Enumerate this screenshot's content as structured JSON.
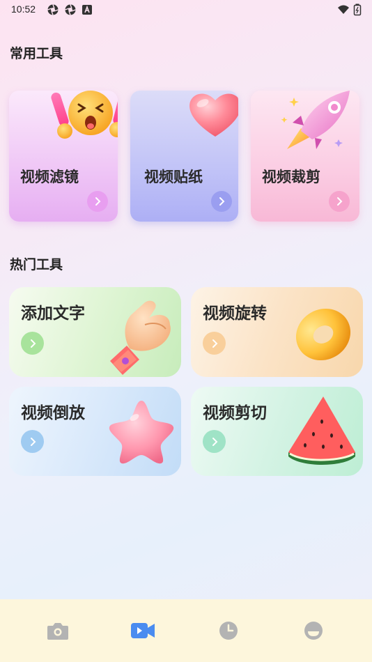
{
  "status_bar": {
    "time": "10:52",
    "left_icons": [
      "aperture-icon",
      "aperture-icon",
      "a-badge-icon"
    ],
    "right_icons": [
      "wifi-icon",
      "battery-icon"
    ]
  },
  "sections": {
    "common_tools": {
      "title": "常用工具",
      "items": [
        {
          "label": "视频滤镜",
          "icon": "cheering-emoji-icon",
          "accent": "#e6a3f2"
        },
        {
          "label": "视频贴纸",
          "icon": "heart-icon",
          "accent": "#a9abf5"
        },
        {
          "label": "视频裁剪",
          "icon": "rocket-icon",
          "accent": "#f6a8d4"
        }
      ]
    },
    "hot_tools": {
      "title": "热门工具",
      "items": [
        {
          "label": "添加文字",
          "icon": "hand-gesture-icon",
          "accent": "#a6e39a"
        },
        {
          "label": "视频旋转",
          "icon": "donut-ring-icon",
          "accent": "#f9cf9b"
        },
        {
          "label": "视频倒放",
          "icon": "star-jelly-icon",
          "accent": "#9fcbf1"
        },
        {
          "label": "视频剪切",
          "icon": "watermelon-icon",
          "accent": "#9fe3c6"
        }
      ]
    }
  },
  "bottom_nav": {
    "items": [
      {
        "icon": "camera-icon",
        "active": false
      },
      {
        "icon": "video-camera-icon",
        "active": true
      },
      {
        "icon": "clock-icon",
        "active": false
      },
      {
        "icon": "profile-icon",
        "active": false
      }
    ],
    "active_color": "#4a8cf0",
    "inactive_color": "#b3b3b3"
  }
}
